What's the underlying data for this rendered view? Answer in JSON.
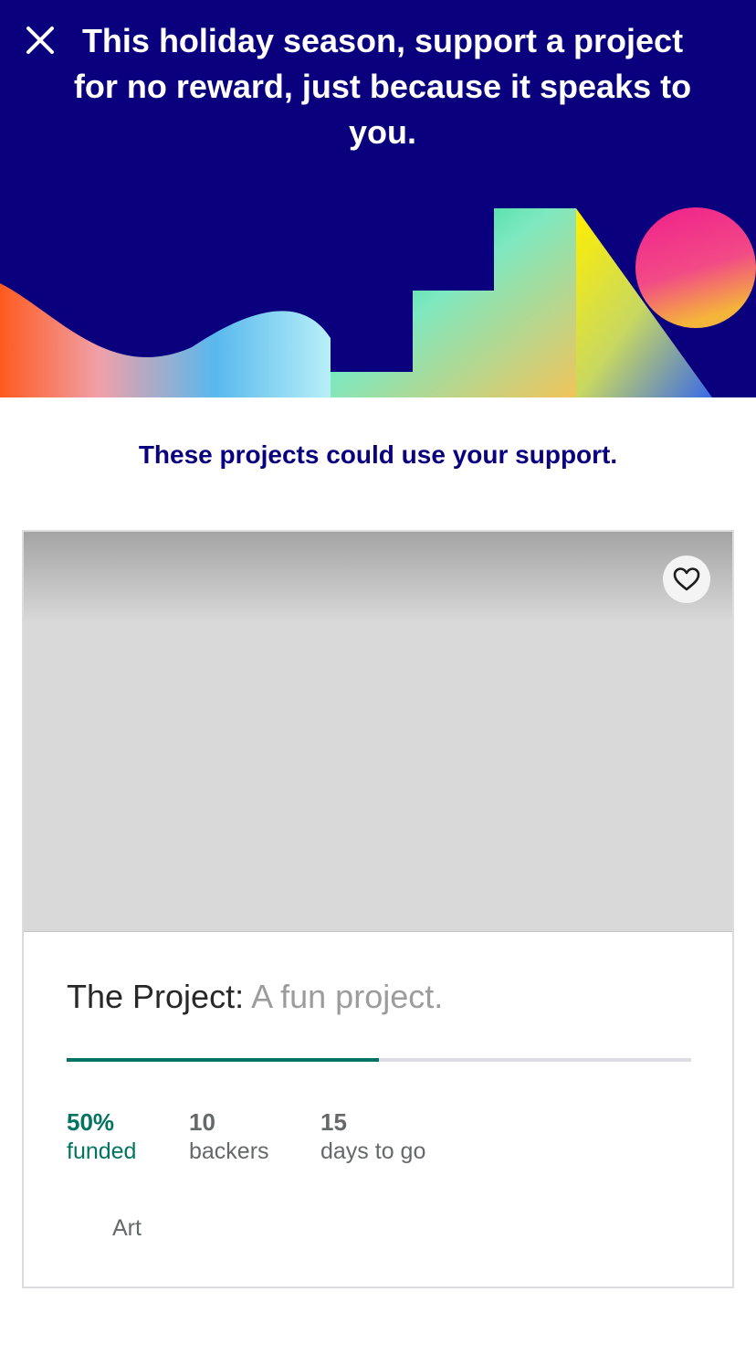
{
  "header": {
    "title": "This holiday season, support a project for no reward, just because it speaks to you.",
    "background": "#0a007e"
  },
  "subheading": "These projects could use your support.",
  "project": {
    "name": "The Project:",
    "blurb": "A fun project.",
    "progress_percent": 50,
    "stats": {
      "funded_value": "50%",
      "funded_label": "funded",
      "backers_value": "10",
      "backers_label": "backers",
      "days_value": "15",
      "days_label": "days to go"
    },
    "category": "Art"
  },
  "colors": {
    "accent_green": "#037362",
    "navy": "#0a007e"
  },
  "icons": {
    "close": "close-icon",
    "save": "heart-icon"
  }
}
